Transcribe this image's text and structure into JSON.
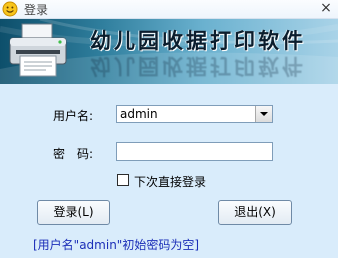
{
  "window": {
    "title": "登录",
    "close_glyph": "×",
    "icon": "smiley-icon"
  },
  "banner": {
    "title": "幼儿园收据打印软件",
    "icon": "printer-icon"
  },
  "form": {
    "username_label": "用户名:",
    "username_value": "admin",
    "password_label": "密　码:",
    "password_value": "",
    "remember_label": "下次直接登录",
    "remember_checked": false
  },
  "buttons": {
    "login_label": "登录(L)",
    "exit_label": "退出(X)"
  },
  "hint": "[用户名\"admin\"初始密码为空]",
  "colors": {
    "background": "#d9ecfb",
    "banner_dark": "#0d4f6b",
    "banner_light": "#a9d3e8",
    "hint_text": "#1c2fb8"
  }
}
